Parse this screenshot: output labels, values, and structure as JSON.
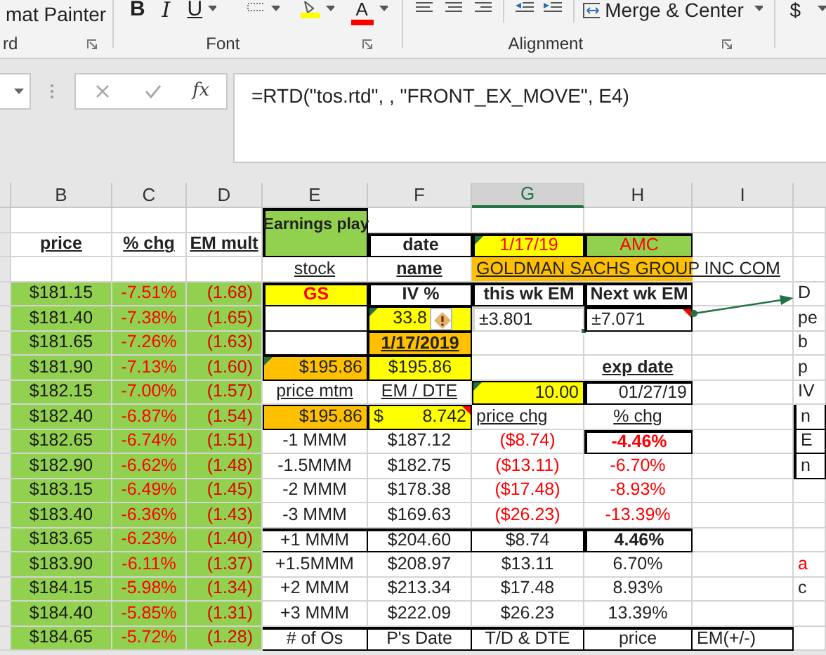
{
  "ribbon": {
    "painter": "mat Painter",
    "bold": "B",
    "italic": "I",
    "underline": "U",
    "font_color": "A",
    "merge": "Merge & Center",
    "currency": "$",
    "clipboard_label": "rd",
    "font_label": "Font",
    "alignment_label": "Alignment"
  },
  "formula_bar": {
    "fx": "fx",
    "formula": "=RTD(\"tos.rtd\", , \"FRONT_EX_MOVE\", E4)"
  },
  "columns": [
    {
      "label": "B",
      "selected": false
    },
    {
      "label": "C",
      "selected": false
    },
    {
      "label": "D",
      "selected": false
    },
    {
      "label": "E",
      "selected": false
    },
    {
      "label": "F",
      "selected": false
    },
    {
      "label": "G",
      "selected": true
    },
    {
      "label": "H",
      "selected": false
    },
    {
      "label": "I",
      "selected": false
    }
  ],
  "rows": [
    {
      "e": {
        "text": "Earnings play",
        "kind": "title"
      }
    },
    {
      "b": {
        "text": "price",
        "kind": "col_head"
      },
      "c": {
        "text": "% chg",
        "kind": "col_head"
      },
      "d": {
        "text": "EM mult",
        "kind": "col_head"
      },
      "f": {
        "text": "date",
        "kind": "label_box"
      },
      "g": {
        "text": "1/17/19",
        "kind": "date",
        "error_flag": true
      },
      "h": {
        "text": "AMC",
        "kind": "ticker_green"
      }
    },
    {
      "e": {
        "text": "stock",
        "kind": "underline"
      },
      "f": {
        "text": "name",
        "kind": "bold_underline"
      },
      "g": {
        "text": "GOLDMAN SACHS GROUP INC COM",
        "kind": "company"
      }
    },
    {
      "b": {
        "text": "$181.15",
        "kind": "price"
      },
      "c": {
        "text": "-7.51%",
        "kind": "pct"
      },
      "d": {
        "text": "(1.68)",
        "kind": "mult"
      },
      "e": {
        "text": "GS",
        "kind": "ticker"
      },
      "f": {
        "text": "IV %",
        "kind": "label_box"
      },
      "g": {
        "text": "this wk EM",
        "kind": "label_box"
      },
      "h": {
        "text": "Next wk EM",
        "kind": "label_box"
      },
      "j": {
        "text": "D",
        "kind": "edge"
      }
    },
    {
      "b": {
        "text": "$181.40",
        "kind": "price"
      },
      "c": {
        "text": "-7.38%",
        "kind": "pct"
      },
      "d": {
        "text": "(1.65)",
        "kind": "mult"
      },
      "e": {
        "kind": "blank_box"
      },
      "f": {
        "text": "33.8",
        "kind": "yellow_num",
        "error_flag": true,
        "warning": true
      },
      "g": {
        "text": "±3.801",
        "kind": "active"
      },
      "h": {
        "text": "±7.071",
        "kind": "em",
        "comment": true
      },
      "j": {
        "text": "pe",
        "kind": "edge"
      }
    },
    {
      "b": {
        "text": "$181.65",
        "kind": "price"
      },
      "c": {
        "text": "-7.26%",
        "kind": "pct"
      },
      "d": {
        "text": "(1.63)",
        "kind": "mult"
      },
      "e": {
        "kind": "blank_box"
      },
      "f": {
        "text": "1/17/2019",
        "kind": "orange_date"
      },
      "j": {
        "text": "b",
        "kind": "edge"
      }
    },
    {
      "b": {
        "text": "$181.90",
        "kind": "price"
      },
      "c": {
        "text": "-7.13%",
        "kind": "pct"
      },
      "d": {
        "text": "(1.60)",
        "kind": "mult"
      },
      "e": {
        "text": "$195.86",
        "kind": "orange_num",
        "error_flag": true
      },
      "f": {
        "text": "$195.86",
        "kind": "yellow_center"
      },
      "h": {
        "text": "exp date",
        "kind": "bold_underline"
      },
      "j": {
        "text": "p",
        "kind": "edge"
      }
    },
    {
      "b": {
        "text": "$182.15",
        "kind": "price"
      },
      "c": {
        "text": "-7.00%",
        "kind": "pct"
      },
      "d": {
        "text": "(1.57)",
        "kind": "mult"
      },
      "e": {
        "text": "price mtm",
        "kind": "underline"
      },
      "f": {
        "text": "EM /  DTE",
        "kind": "underline"
      },
      "g": {
        "text": "10.00",
        "kind": "yellow_num",
        "error_flag": true
      },
      "h": {
        "text": "01/27/19",
        "kind": "box_right"
      },
      "j": {
        "text": "IV",
        "kind": "edge"
      }
    },
    {
      "b": {
        "text": "$182.40",
        "kind": "price"
      },
      "c": {
        "text": "-6.87%",
        "kind": "pct"
      },
      "d": {
        "text": "(1.54)",
        "kind": "mult"
      },
      "e": {
        "text": "$195.86",
        "kind": "orange_num"
      },
      "f": {
        "prefix": "$",
        "text": "8.742",
        "kind": "yellow_num",
        "comment": true
      },
      "g": {
        "text": "price chg",
        "kind": "underline_left"
      },
      "h": {
        "text": "% chg",
        "kind": "underline"
      },
      "j": {
        "text": "n",
        "kind": "edge_box"
      }
    },
    {
      "b": {
        "text": "$182.65",
        "kind": "price"
      },
      "c": {
        "text": "-6.74%",
        "kind": "pct"
      },
      "d": {
        "text": "(1.51)",
        "kind": "mult"
      },
      "e": {
        "text": "-1 MMM",
        "kind": "plain"
      },
      "f": {
        "text": "$187.12",
        "kind": "plain"
      },
      "g": {
        "text": "($8.74)",
        "kind": "neg"
      },
      "h": {
        "text": "-4.46%",
        "kind": "neg_bold"
      },
      "j": {
        "text": "E",
        "kind": "edge_box"
      }
    },
    {
      "b": {
        "text": "$182.90",
        "kind": "price"
      },
      "c": {
        "text": "-6.62%",
        "kind": "pct"
      },
      "d": {
        "text": "(1.48)",
        "kind": "mult"
      },
      "e": {
        "text": "-1.5MMM",
        "kind": "plain"
      },
      "f": {
        "text": "$182.75",
        "kind": "plain"
      },
      "g": {
        "text": "($13.11)",
        "kind": "neg"
      },
      "h": {
        "text": "-6.70%",
        "kind": "neg"
      },
      "j": {
        "text": "n",
        "kind": "edge_box"
      }
    },
    {
      "b": {
        "text": "$183.15",
        "kind": "price"
      },
      "c": {
        "text": "-6.49%",
        "kind": "pct"
      },
      "d": {
        "text": "(1.45)",
        "kind": "mult"
      },
      "e": {
        "text": "-2 MMM",
        "kind": "plain"
      },
      "f": {
        "text": "$178.38",
        "kind": "plain"
      },
      "g": {
        "text": "($17.48)",
        "kind": "neg"
      },
      "h": {
        "text": "-8.93%",
        "kind": "neg"
      }
    },
    {
      "b": {
        "text": "$183.40",
        "kind": "price"
      },
      "c": {
        "text": "-6.36%",
        "kind": "pct"
      },
      "d": {
        "text": "(1.43)",
        "kind": "mult"
      },
      "e": {
        "text": "-3 MMM",
        "kind": "plain"
      },
      "f": {
        "text": "$169.63",
        "kind": "plain"
      },
      "g": {
        "text": "($26.23)",
        "kind": "neg"
      },
      "h": {
        "text": "-13.39%",
        "kind": "neg"
      }
    },
    {
      "b": {
        "text": "$183.65",
        "kind": "price"
      },
      "c": {
        "text": "-6.23%",
        "kind": "pct"
      },
      "d": {
        "text": "(1.40)",
        "kind": "mult"
      },
      "e": {
        "text": "+1 MMM",
        "kind": "plain_top"
      },
      "f": {
        "text": "$204.60",
        "kind": "plain_top"
      },
      "g": {
        "text": "$8.74",
        "kind": "plain_top"
      },
      "h": {
        "text": "4.46%",
        "kind": "pos_bold"
      }
    },
    {
      "b": {
        "text": "$183.90",
        "kind": "price"
      },
      "c": {
        "text": "-6.11%",
        "kind": "pct"
      },
      "d": {
        "text": "(1.37)",
        "kind": "mult"
      },
      "e": {
        "text": "+1.5MMM",
        "kind": "plain"
      },
      "f": {
        "text": "$208.97",
        "kind": "plain"
      },
      "g": {
        "text": "$13.11",
        "kind": "plain"
      },
      "h": {
        "text": "6.70%",
        "kind": "plain"
      },
      "j": {
        "text": "a",
        "kind": "edge_red"
      }
    },
    {
      "b": {
        "text": "$184.15",
        "kind": "price"
      },
      "c": {
        "text": "-5.98%",
        "kind": "pct"
      },
      "d": {
        "text": "(1.34)",
        "kind": "mult"
      },
      "e": {
        "text": "+2 MMM",
        "kind": "plain"
      },
      "f": {
        "text": "$213.34",
        "kind": "plain"
      },
      "g": {
        "text": "$17.48",
        "kind": "plain"
      },
      "h": {
        "text": "8.93%",
        "kind": "plain"
      },
      "j": {
        "text": "c",
        "kind": "edge"
      }
    },
    {
      "b": {
        "text": "$184.40",
        "kind": "price"
      },
      "c": {
        "text": "-5.85%",
        "kind": "pct"
      },
      "d": {
        "text": "(1.31)",
        "kind": "mult"
      },
      "e": {
        "text": "+3 MMM",
        "kind": "plain"
      },
      "f": {
        "text": "$222.09",
        "kind": "plain"
      },
      "g": {
        "text": "$26.23",
        "kind": "plain"
      },
      "h": {
        "text": "13.39%",
        "kind": "plain"
      }
    },
    {
      "b": {
        "text": "$184.65",
        "kind": "price"
      },
      "c": {
        "text": "-5.72%",
        "kind": "pct"
      },
      "d": {
        "text": "(1.28)",
        "kind": "mult"
      },
      "e": {
        "text": "# of Os",
        "kind": "plain_top"
      },
      "f": {
        "text": "P's Date",
        "kind": "plain_top"
      },
      "g": {
        "text": "T/D & DTE",
        "kind": "plain_top"
      },
      "h": {
        "text": "price",
        "kind": "plain_top"
      },
      "i": {
        "text": "EM(+/-)",
        "kind": "plain_top_left"
      }
    }
  ]
}
